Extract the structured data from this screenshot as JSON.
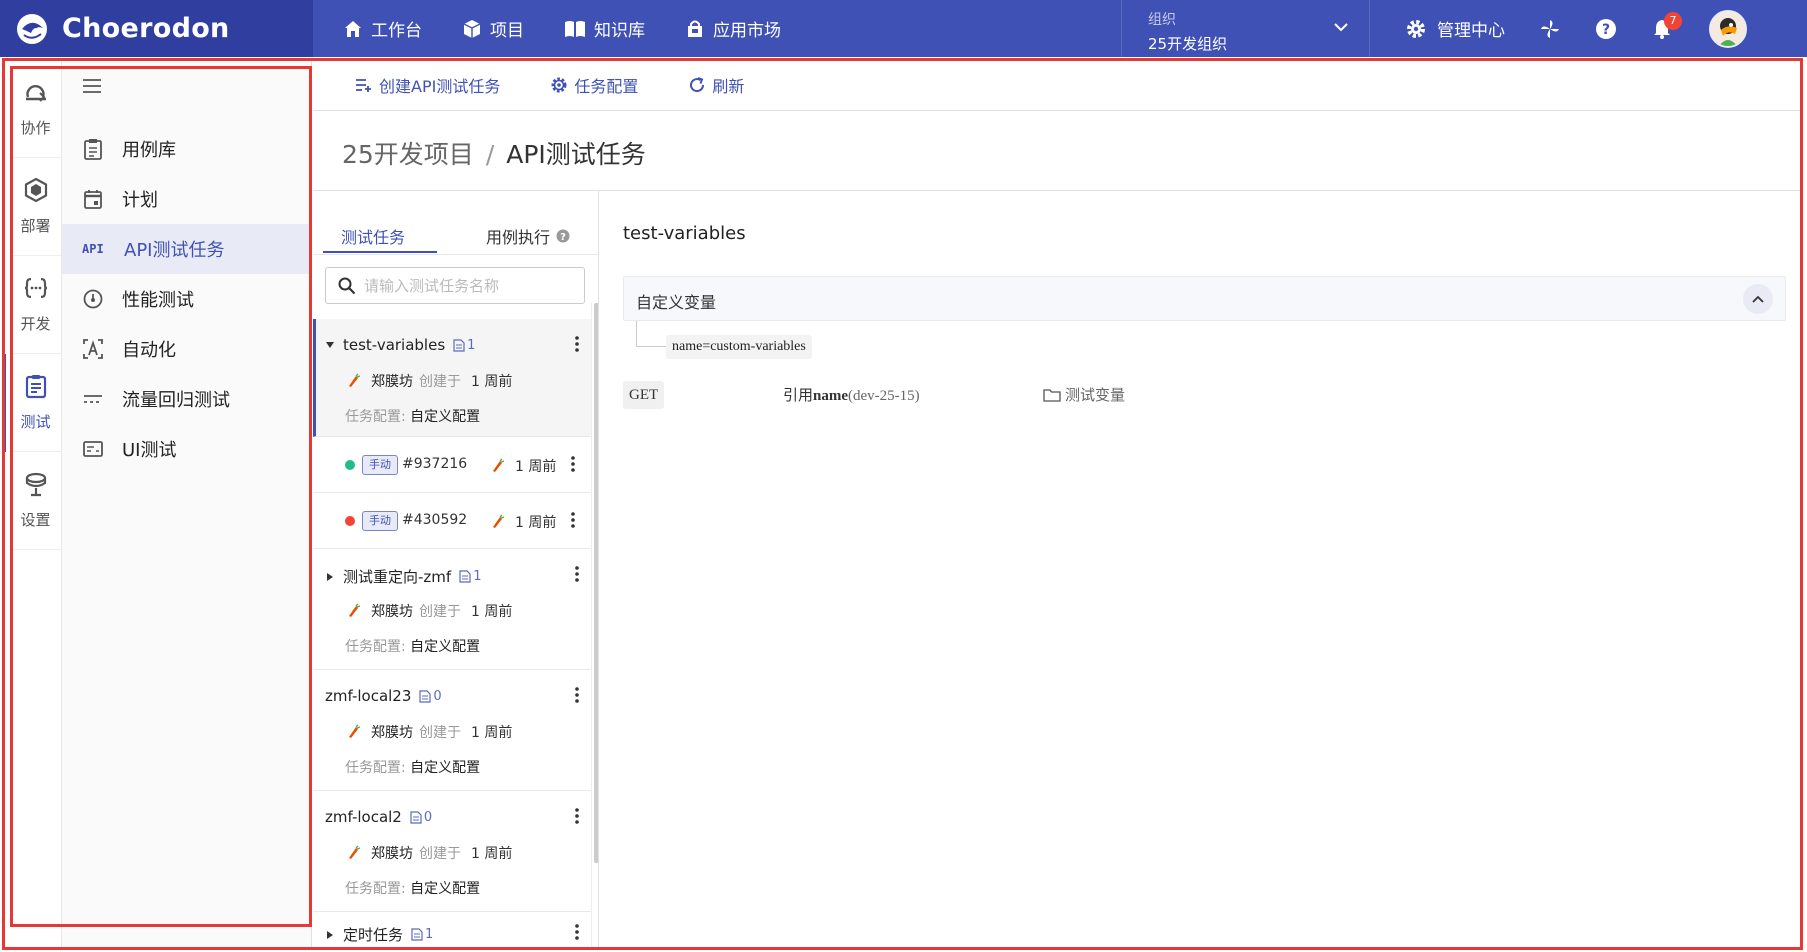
{
  "app": {
    "name": "Choerodon"
  },
  "topnav": [
    {
      "label": "工作台",
      "icon": "home-icon"
    },
    {
      "label": "项目",
      "icon": "cube-icon"
    },
    {
      "label": "知识库",
      "icon": "book-icon"
    },
    {
      "label": "应用市场",
      "icon": "store-icon"
    }
  ],
  "org": {
    "label": "组织",
    "value": "25开发组织"
  },
  "topright": {
    "management": "管理中心",
    "notifications": "7"
  },
  "rail": [
    {
      "label": "协作",
      "icon": "collaborate-icon"
    },
    {
      "label": "部署",
      "icon": "deploy-icon"
    },
    {
      "label": "开发",
      "icon": "develop-icon"
    },
    {
      "label": "测试",
      "icon": "test-icon",
      "active": true
    },
    {
      "label": "设置",
      "icon": "settings-icon"
    }
  ],
  "menu": [
    {
      "label": "用例库",
      "icon": "clipboard-icon"
    },
    {
      "label": "计划",
      "icon": "calendar-icon"
    },
    {
      "label": "API测试任务",
      "icon": "api-icon",
      "icon_text": "API",
      "active": true
    },
    {
      "label": "性能测试",
      "icon": "gauge-icon"
    },
    {
      "label": "自动化",
      "icon": "automation-icon"
    },
    {
      "label": "流量回归测试",
      "icon": "traffic-icon"
    },
    {
      "label": "UI测试",
      "icon": "ui-test-icon"
    }
  ],
  "toolbar": {
    "create": "创建API测试任务",
    "config": "任务配置",
    "refresh": "刷新"
  },
  "breadcrumb": {
    "project": "25开发项目",
    "sep": "/",
    "page": "API测试任务"
  },
  "tabs": {
    "tasks": "测试任务",
    "executions": "用例执行"
  },
  "search": {
    "placeholder": "请输入测试任务名称"
  },
  "tasks": [
    {
      "name": "test-variables",
      "count": "1",
      "author": "郑膜坊",
      "created_label": "创建于",
      "time": "1 周前",
      "config_label": "任务配置:",
      "config_value": "自定义配置",
      "expanded": true
    },
    {
      "name": "测试重定向-zmf",
      "count": "1",
      "author": "郑膜坊",
      "created_label": "创建于",
      "time": "1 周前",
      "config_label": "任务配置:",
      "config_value": "自定义配置"
    },
    {
      "name": "zmf-local23",
      "count": "0",
      "author": "郑膜坊",
      "created_label": "创建于",
      "time": "1 周前",
      "config_label": "任务配置:",
      "config_value": "自定义配置"
    },
    {
      "name": "zmf-local2",
      "count": "0",
      "author": "郑膜坊",
      "created_label": "创建于",
      "time": "1 周前",
      "config_label": "任务配置:",
      "config_value": "自定义配置"
    },
    {
      "name": "定时任务",
      "count": "1"
    }
  ],
  "executions": [
    {
      "tag": "手动",
      "id": "#937216",
      "time": "1 周前",
      "status_color": "#1fbc8c"
    },
    {
      "tag": "手动",
      "id": "#430592",
      "time": "1 周前",
      "status_color": "#f44336"
    }
  ],
  "detail": {
    "title": "test-variables",
    "variables_label": "自定义变量",
    "variable": "name=custom-variables",
    "method": "GET",
    "ref_prefix": "引用",
    "ref_name": "name",
    "ref_env": "(dev-25-15)",
    "folder": "测试变量"
  },
  "colors": {
    "primary": "#3f51b5",
    "brand_dark": "#303f9f",
    "highlight": "#e53935"
  }
}
